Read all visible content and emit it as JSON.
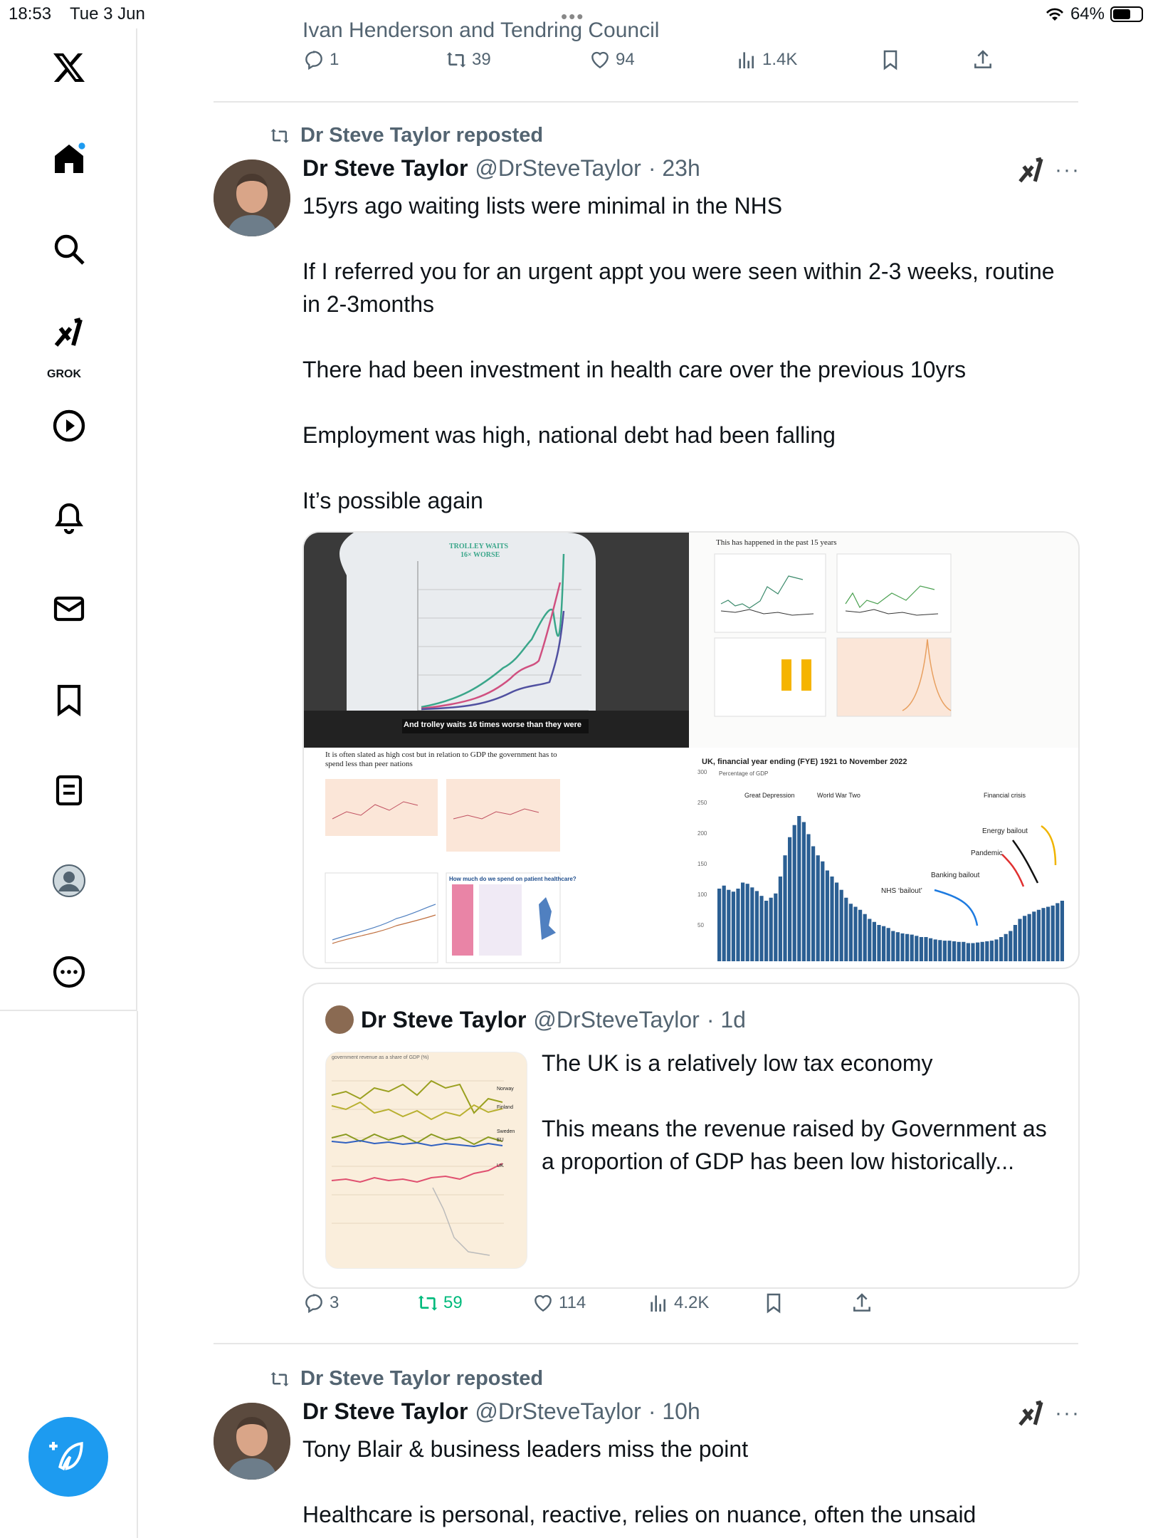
{
  "status": {
    "time": "18:53",
    "date": "Tue 3 Jun",
    "battery": "64%",
    "battery_level": 0.64
  },
  "sidebar": {
    "grok_label": "GROK"
  },
  "prev_post": {
    "name_line": "Ivan Henderson and Tendring Council",
    "replies": "1",
    "reposts": "39",
    "likes": "94",
    "views": "1.4K"
  },
  "post1": {
    "repost_label": "Dr Steve Taylor reposted",
    "name": "Dr Steve Taylor",
    "handle": "@DrSteveTaylor",
    "time": "· 23h",
    "text": "15yrs ago waiting lists were minimal in the NHS\n\nIf I referred you for an urgent appt you were seen within 2-3 weeks, routine in 2-3months\n\nThere had been investment in health care over the previous 10yrs\n\nEmployment was high, national debt had been falling\n\nIt’s possible again",
    "media": {
      "img1_title": "TROLLEY WAITS\n16× WORSE",
      "img1_caption": "And trolley waits 16 times worse than they were",
      "img2_title": "This has happened in the past 15 years",
      "img3_title": "It is often slated as high cost but in relation to GDP the government has to spend less than peer nations",
      "img3_sub": "How much do we spend on patient healthcare?",
      "img4_title": "UK, financial year ending (FYE) 1921 to November 2022",
      "img4_ylabel": "Percentage of GDP",
      "img4_labels": [
        "Great Depression",
        "World War Two",
        "Financial crisis",
        "Energy bailout",
        "Pandemic",
        "Banking bailout",
        "NHS ‘bailout’"
      ],
      "img4_ticks": [
        "300",
        "250",
        "200",
        "150",
        "100",
        "50"
      ]
    },
    "quote": {
      "name": "Dr Steve Taylor",
      "handle": "@DrSteveTaylor",
      "time": "· 1d",
      "text": "The UK is a relatively low tax economy\n\nThis means the revenue raised by Government as a proportion of GDP has been low historically...",
      "img_title": "government revenue as a share of GDP (%)",
      "img_labels": [
        "Norway",
        "Finland",
        "Sweden",
        "EU",
        "UK"
      ]
    },
    "replies": "3",
    "reposts": "59",
    "likes": "114",
    "views": "4.2K"
  },
  "post2": {
    "repost_label": "Dr Steve Taylor reposted",
    "name": "Dr Steve Taylor",
    "handle": "@DrSteveTaylor",
    "time": "· 10h",
    "text": "Tony Blair & business leaders miss the point\n\nHealthcare is personal, reactive, relies on nuance, often the unsaid"
  },
  "colors": {
    "accent": "#1d9bf0",
    "repost_green": "#00ba7c",
    "muted": "#536471"
  }
}
